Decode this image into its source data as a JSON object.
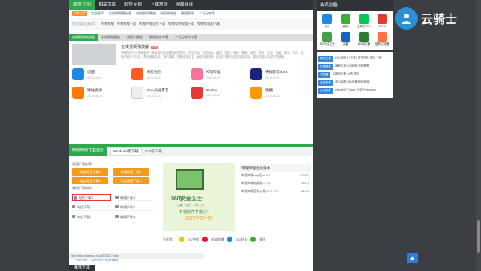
{
  "nav": {
    "tabs": [
      "软件介绍",
      "相关文章",
      "软件专题",
      "下载地址",
      "网友评论"
    ]
  },
  "subnav": {
    "badge": "下载之家",
    "items": [
      "为您推荐",
      "在线视频播放器",
      "在线视频播放",
      "流媒体播放",
      "影视视频",
      "二次元软件"
    ]
  },
  "search": {
    "label": "热点搜索关键字：",
    "items": [
      "哔哩哔哩",
      "哔哩哔哩下载",
      "哔哩哔哩官方下载",
      "哔哩哔哩视频下载",
      "哔哩哔哩客户端"
    ]
  },
  "topics": [
    "在线视频播放器",
    "在线视频播放",
    "流媒体播放",
    "影视软件专题",
    "二次元软件专题"
  ],
  "feature": {
    "title": "在线视频播放器",
    "tag": "专题",
    "desc": "哔哩哔哩个人最新版是一款能够在线观看视频的软件，内容丰富，包括动画、番剧、国创、音乐、舞蹈、游戏、科技、生活、鬼畜、娱乐、时尚、放映厅等多个分区，界面清爽简洁，操作简单，视频资源丰富，画质清晰流畅，给用户带来极佳的观影体验，喜欢的朋友欢迎下载使用。"
  },
  "apps": [
    {
      "name": "优酷",
      "date": "2019-10-31",
      "color": "#1e88e5"
    },
    {
      "name": "风行视频",
      "date": "2019-10-31",
      "color": "#ff5a1f"
    },
    {
      "name": "哔哩哔哩",
      "date": "2019-10-31",
      "color": "#fb7299"
    },
    {
      "name": "央视影音cbox",
      "date": "2019-10-31",
      "color": "#1a237e"
    },
    {
      "name": "咪咕视频",
      "date": "2019-06-15",
      "color": "#ff7a00"
    },
    {
      "name": "cbox央视影音",
      "date": "2019-10-31",
      "color": "#eeeeee"
    },
    {
      "name": "iBudou",
      "date": "2019-08-28",
      "color": "#e53935"
    },
    {
      "name": "快播",
      "date": "2019-06-15",
      "color": "#ff9800"
    }
  ],
  "download": {
    "header": "哔哩哔哩下载地址",
    "tab_windows": "Windows版下载",
    "tab_ios": "iOS版下载",
    "recommend_label": "高速下载推荐：",
    "btn1": "电信高速下载1",
    "btn2": "电信高速下载2",
    "btn3": "电信高速下载1",
    "btn4": "电信高速下载2",
    "mirror_label": "其他下载地址：",
    "mirrors": [
      "电信下载1",
      "联通下载1",
      "电信下载2",
      "联通下载2",
      "电信下载3",
      "联通下载3"
    ],
    "note_a": "下载问题？",
    "note_b": "点击报错",
    "note_c": "·投诉·建议"
  },
  "promo": {
    "title": "360安全卫士",
    "subtitle": "拦截 · 防护 · 十年卫士",
    "cta": "下载软件不放心？",
    "cta2": "360卫士扫一扫"
  },
  "related": {
    "header": "哔哩哔哩相关版本",
    "items": [
      {
        "name": "哔哩哔哩uwp版v1.4.7",
        "date": "10-21"
      },
      {
        "name": "哔哩哔哩电脑版v1.4.7",
        "date": "09-12"
      },
      {
        "name": "哔哩哔哩官方pc版v1.2.17.0",
        "date": "08-16"
      }
    ]
  },
  "share": {
    "label": "分享到：",
    "items": [
      {
        "name": "QQ空间",
        "color": "#f5c400"
      },
      {
        "name": "新浪微博",
        "color": "#e6162d"
      },
      {
        "name": "QQ好友",
        "color": "#1e88e5"
      },
      {
        "name": "微信",
        "color": "#3cb034"
      }
    ]
  },
  "status_url": "http://www.downza.cn/soft/223237.html",
  "bottom_tab": "推荐下载",
  "right": {
    "title": "装机必备",
    "apps": [
      {
        "name": "QQ",
        "color": "#1e88e5"
      },
      {
        "name": "微信",
        "color": "#3cb034"
      },
      {
        "name": "爱奇艺PPS",
        "color": "#00c853"
      },
      {
        "name": "WPS",
        "color": "#e53935"
      },
      {
        "name": "360安全卫士",
        "color": "#43a047"
      },
      {
        "name": "迅雷",
        "color": "#1565c0"
      },
      {
        "name": "360浏览器",
        "color": "#2e7d32"
      },
      {
        "name": "搜狗浏览器",
        "color": "#ff7043"
      }
    ],
    "rows": [
      {
        "badge": "聊天工具",
        "text": "QQ 微信 YY 钉钉 阿里旺旺 陌陌 飞信"
      },
      {
        "badge": "影音播放",
        "text": "暴风影音 QQ影音 迅雷看看"
      },
      {
        "badge": "浏览器",
        "text": "谷歌浏览器 火狐 搜狗"
      },
      {
        "badge": "安全杀毒",
        "text": "金山毒霸 360杀毒 电脑管家"
      },
      {
        "badge": "办公软件",
        "text": "office2007 Word 永中 Photoshop"
      }
    ]
  },
  "logo_text": "云骑士"
}
